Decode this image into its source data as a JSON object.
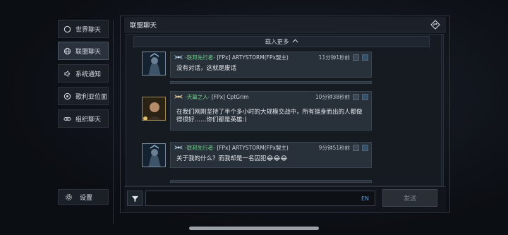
{
  "sidebar": {
    "items": [
      {
        "label": "世界聊天",
        "icon": "globe-refresh-icon",
        "active": false
      },
      {
        "label": "联盟聊天",
        "icon": "globe-icon",
        "active": true
      },
      {
        "label": "系统通知",
        "icon": "speaker-icon",
        "active": false
      },
      {
        "label": "歌利亚位面",
        "icon": "planet-refresh-icon",
        "active": false
      },
      {
        "label": "组织聊天",
        "icon": "link-icon",
        "active": false
      }
    ],
    "settings_label": "设置"
  },
  "header": {
    "title": "联盟聊天"
  },
  "chat": {
    "load_more": "载入更多",
    "messages": [
      {
        "tag": "-联邦先行者-",
        "sender": "[FPx] ARTYSTORM(FPx盟主)",
        "time": "11分钟1秒前",
        "text": "没有对话，这就是废话"
      },
      {
        "tag": "-天幕之人-",
        "sender": "[FPx] CptGrim",
        "time": "10分钟38秒前",
        "text": "在我们刚刚坚持了半个多小时的大规模交战中，所有挺身而出的人都做得很好……你们都是英雄:)"
      },
      {
        "tag": "-联邦先行者-",
        "sender": "[FPx] ARTYSTORM(FPx盟主)",
        "time": "9分钟51秒前",
        "text": "关于我的什么？而我却是一名囚犯😂😂😂"
      }
    ]
  },
  "input": {
    "lang": "EN",
    "send_label": "发送"
  },
  "colors": {
    "tag_green": "#6fd18a",
    "accent_blue": "#5a9bd8"
  }
}
